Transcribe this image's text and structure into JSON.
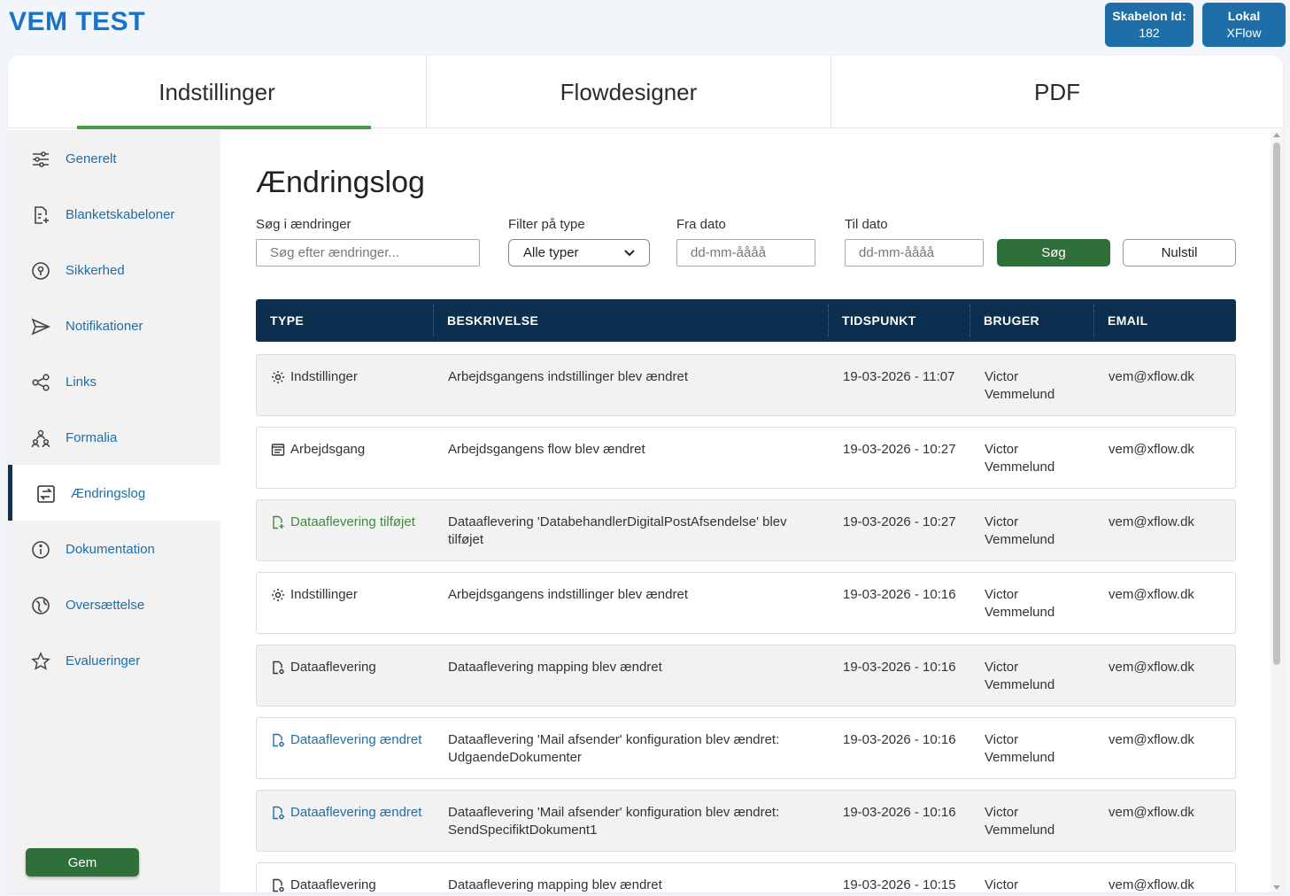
{
  "app": {
    "title": "VEM TEST"
  },
  "badges": {
    "skabelon": {
      "label": "Skabelon Id:",
      "value": "182"
    },
    "lokal": {
      "label": "Lokal",
      "value": "XFlow"
    }
  },
  "tabs": [
    {
      "label": "Indstillinger",
      "active": true
    },
    {
      "label": "Flowdesigner"
    },
    {
      "label": "PDF"
    }
  ],
  "sidebar": {
    "items": [
      {
        "label": "Generelt",
        "icon": "sliders-icon"
      },
      {
        "label": "Blanketskabeloner",
        "icon": "document-add-icon"
      },
      {
        "label": "Sikkerhed",
        "icon": "keyhole-icon"
      },
      {
        "label": "Notifikationer",
        "icon": "send-icon"
      },
      {
        "label": "Links",
        "icon": "share-icon"
      },
      {
        "label": "Formalia",
        "icon": "people-icon"
      },
      {
        "label": "Ændringslog",
        "icon": "swap-icon",
        "active": true
      },
      {
        "label": "Dokumentation",
        "icon": "info-icon"
      },
      {
        "label": "Oversættelse",
        "icon": "translate-icon"
      },
      {
        "label": "Evalueringer",
        "icon": "star-icon"
      }
    ],
    "save_label": "Gem"
  },
  "main": {
    "title": "Ændringslog",
    "filters": {
      "search_label": "Søg i ændringer",
      "search_placeholder": "Søg efter ændringer...",
      "type_label": "Filter på type",
      "type_value": "Alle typer",
      "from_label": "Fra dato",
      "from_placeholder": "dd-mm-åååå",
      "to_label": "Til dato",
      "to_placeholder": "dd-mm-åååå",
      "search_button": "Søg",
      "reset_button": "Nulstil"
    },
    "table": {
      "columns": [
        "TYPE",
        "BESKRIVELSE",
        "TIDSPUNKT",
        "BRUGER",
        "EMAIL"
      ],
      "rows": [
        {
          "type": "Indstillinger",
          "icon": "settings-icon",
          "color": "#333333",
          "desc": "Arbejdsgangens indstillinger blev ændret",
          "time": "19-03-2026 - 11:07",
          "user": "Victor Vemmelund",
          "email": "vem@xflow.dk"
        },
        {
          "type": "Arbejdsgang",
          "icon": "flow-icon",
          "color": "#333333",
          "desc": "Arbejdsgangens flow blev ændret",
          "time": "19-03-2026 - 10:27",
          "user": "Victor Vemmelund",
          "email": "vem@xflow.dk"
        },
        {
          "type": "Dataaflevering tilføjet",
          "icon": "file-add-icon",
          "color": "#3e8a3e",
          "desc": "Dataaflevering 'DatabehandlerDigitalPostAfsendelse' blev tilføjet",
          "time": "19-03-2026 - 10:27",
          "user": "Victor Vemmelund",
          "email": "vem@xflow.dk"
        },
        {
          "type": "Indstillinger",
          "icon": "settings-icon",
          "color": "#333333",
          "desc": "Arbejdsgangens indstillinger blev ændret",
          "time": "19-03-2026 - 10:16",
          "user": "Victor Vemmelund",
          "email": "vem@xflow.dk"
        },
        {
          "type": "Dataaflevering",
          "icon": "file-settings-icon",
          "color": "#333333",
          "desc": "Dataaflevering mapping blev ændret",
          "time": "19-03-2026 - 10:16",
          "user": "Victor Vemmelund",
          "email": "vem@xflow.dk"
        },
        {
          "type": "Dataaflevering ændret",
          "icon": "file-edit-icon",
          "color": "#1e6ea8",
          "desc": "Dataaflevering 'Mail afsender' konfiguration blev ændret: UdgaendeDokumenter",
          "time": "19-03-2026 - 10:16",
          "user": "Victor Vemmelund",
          "email": "vem@xflow.dk"
        },
        {
          "type": "Dataaflevering ændret",
          "icon": "file-edit-icon",
          "color": "#1e6ea8",
          "desc": "Dataaflevering 'Mail afsender' konfiguration blev ændret: SendSpecifiktDokument1",
          "time": "19-03-2026 - 10:16",
          "user": "Victor Vemmelund",
          "email": "vem@xflow.dk"
        },
        {
          "type": "Dataaflevering",
          "icon": "file-settings-icon",
          "color": "#333333",
          "desc": "Dataaflevering mapping blev ændret",
          "time": "19-03-2026 - 10:15",
          "user": "Victor",
          "email": "vem@xflow.dk"
        }
      ]
    }
  }
}
